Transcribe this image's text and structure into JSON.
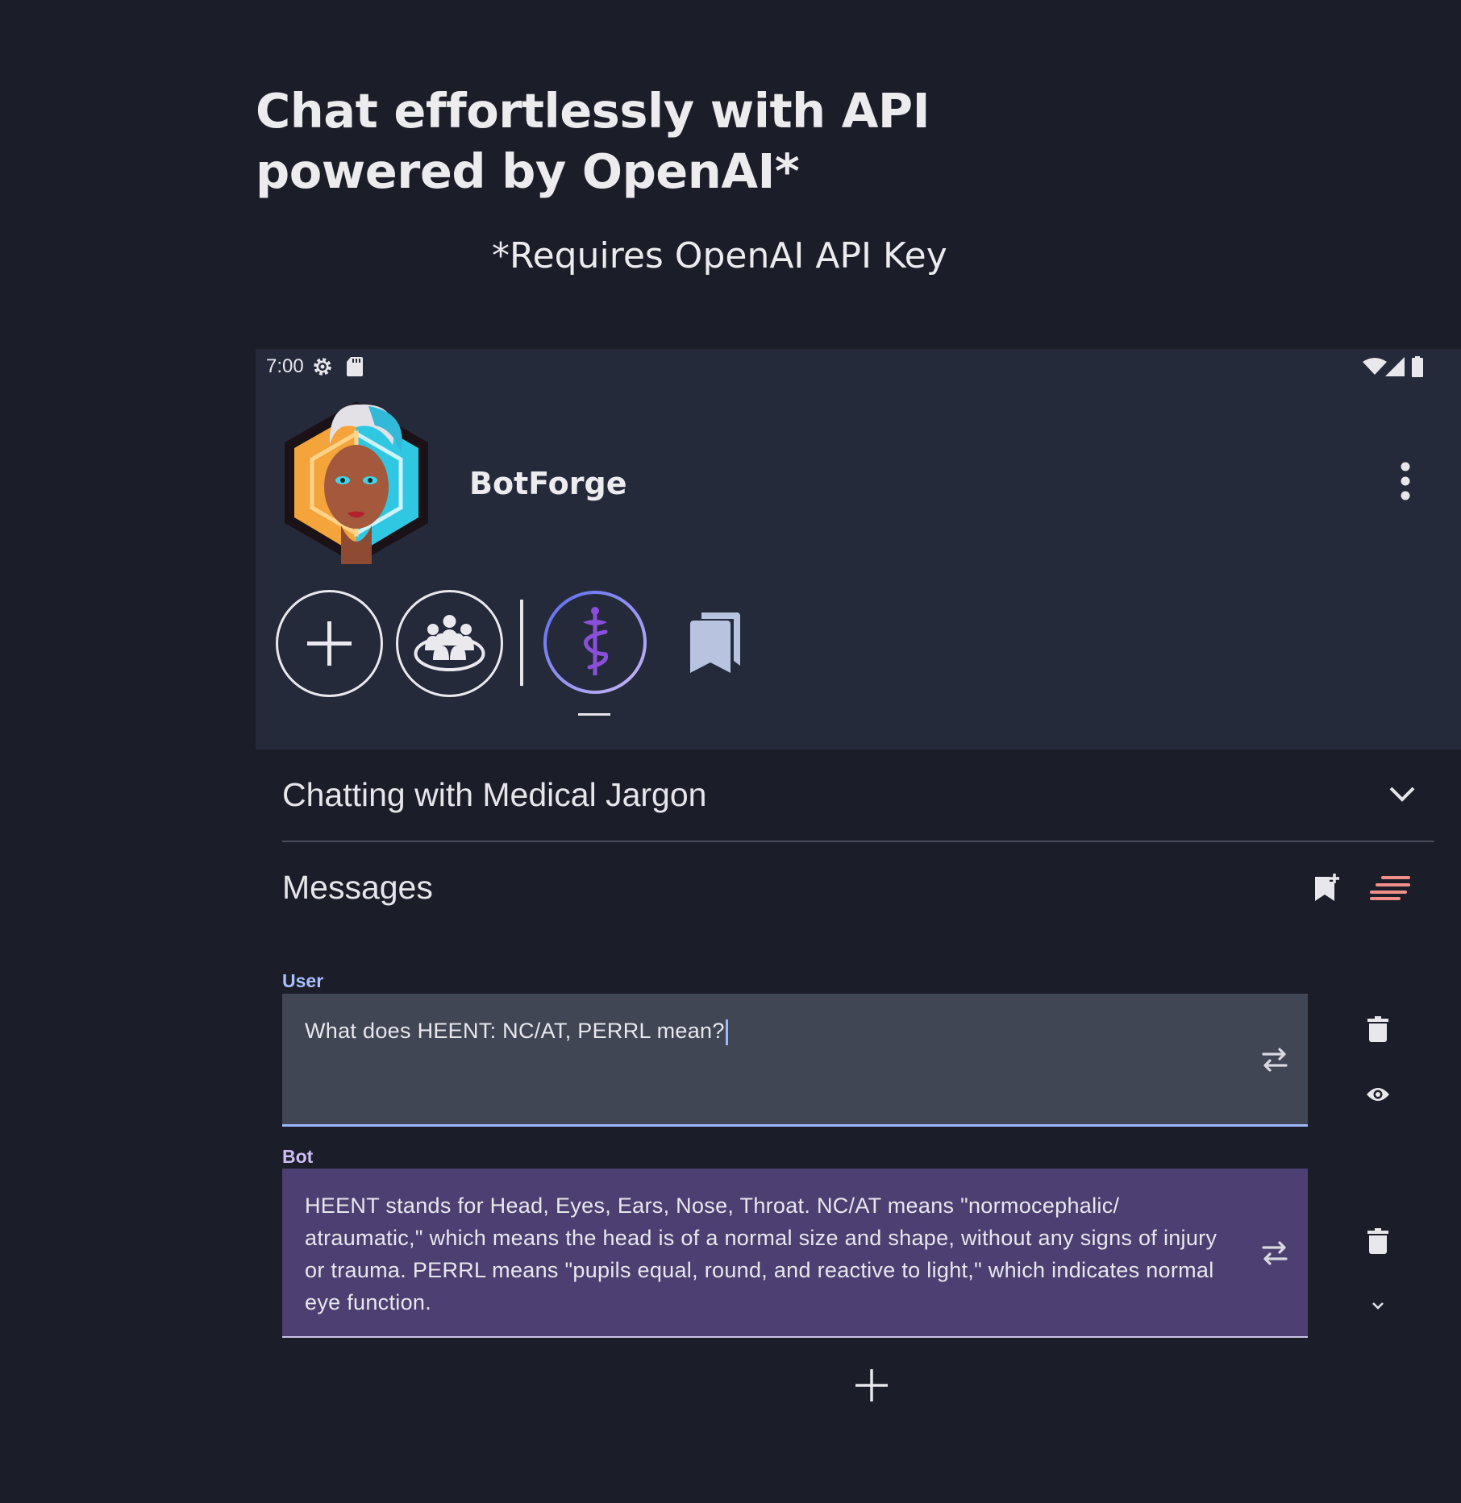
{
  "promo": {
    "headline_line1": "Chat effortlessly with API",
    "headline_line2": "powered by OpenAI*",
    "footnote": "*Requires OpenAI API Key"
  },
  "status_bar": {
    "time": "7:00"
  },
  "app": {
    "name": "BotForge"
  },
  "toolbar": {
    "icons": [
      "add-icon",
      "group-icon",
      "caduceus-icon",
      "bookmarks-icon"
    ]
  },
  "conversation": {
    "title": "Chatting with Medical Jargon"
  },
  "messages_section": {
    "label": "Messages"
  },
  "messages": [
    {
      "role": "User",
      "text": "What does HEENT: NC/AT, PERRL mean?"
    },
    {
      "role": "Bot",
      "text": "HEENT stands for Head, Eyes, Ears, Nose, Throat. NC/AT means \"normocephalic/ atraumatic,\" which means the head is of a normal size and shape, without any signs of injury or trauma. PERRL means \"pupils equal, round, and reactive to light,\" which indicates normal eye function."
    }
  ],
  "colors": {
    "background": "#1b1d29",
    "panel": "#252a3b",
    "user_box": "#414654",
    "bot_box": "#4d3f72",
    "user_label": "#a9c0ff",
    "bot_label": "#cdbdf5",
    "accent_purple": "#7b4fd6",
    "clear_icon": "#f08f87"
  }
}
